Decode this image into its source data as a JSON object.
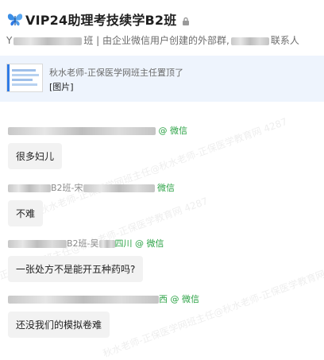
{
  "header": {
    "title": "VIP24助理考技续学B2班",
    "subtitle_prefix": "Y",
    "subtitle_mid": "班 | 由企业微信用户创建的外部群,",
    "subtitle_suffix": "联系人"
  },
  "pinned": {
    "name": "秋水老师-正保医学网班主任置顶了",
    "message": "[图片]"
  },
  "messages": [
    {
      "sender_tail": "@ 微信",
      "text": "很多妇儿"
    },
    {
      "sender_mid": "B2班-宋",
      "sender_tail": "微信",
      "text": "不难"
    },
    {
      "sender_mid": "B2班-吴",
      "sender_tail": "四川 @ 微信",
      "text": "一张处方不是能开五种药吗?"
    },
    {
      "sender_tail": "西 @ 微信",
      "text": "还没我们的模拟卷难"
    }
  ],
  "watermark": "秋水老师-正保医学网班主任@秋水老师-正保医学教育网 4287"
}
